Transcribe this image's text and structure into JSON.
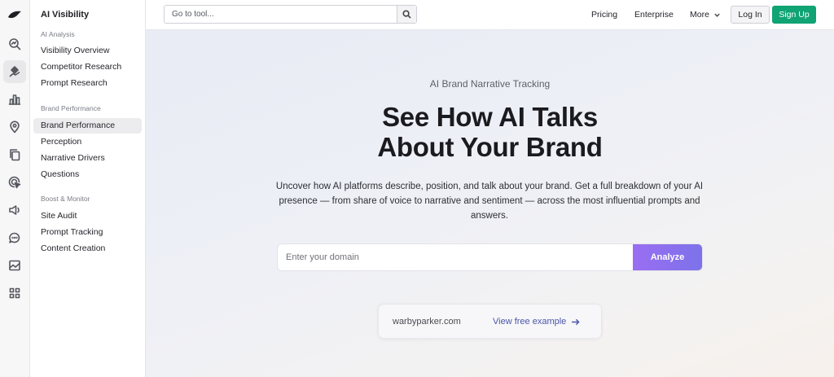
{
  "icons": {
    "logo": "bird-logo-icon",
    "rail": [
      "analytics-search-icon",
      "ai-visibility-icon",
      "bar-chart-icon",
      "location-pin-icon",
      "copy-pages-icon",
      "target-cursor-icon",
      "megaphone-icon",
      "chat-bubble-icon",
      "image-chart-icon",
      "grid-apps-icon"
    ],
    "search": "magnifier-icon",
    "more": "chevron-down-icon",
    "arrow": "arrow-right-icon"
  },
  "sidebar": {
    "title": "AI Visibility",
    "sections": [
      {
        "label": "AI Analysis",
        "items": [
          "Visibility Overview",
          "Competitor Research",
          "Prompt Research"
        ]
      },
      {
        "label": "Brand Performance",
        "items": [
          "Brand Performance",
          "Perception",
          "Narrative Drivers",
          "Questions"
        ]
      },
      {
        "label": "Boost & Monitor",
        "items": [
          "Site Audit",
          "Prompt Tracking",
          "Content Creation"
        ]
      }
    ],
    "active_item": "Brand Performance"
  },
  "topbar": {
    "search_placeholder": "Go to tool...",
    "nav": {
      "pricing": "Pricing",
      "enterprise": "Enterprise",
      "more": "More"
    },
    "login": "Log In",
    "signup": "Sign Up"
  },
  "hero": {
    "eyebrow": "AI Brand Narrative Tracking",
    "headline_line1": "See How AI Talks",
    "headline_line2": "About Your Brand",
    "description": "Uncover how AI platforms describe, position, and talk about your brand. Get a full breakdown of your AI presence — from share of voice to narrative and sentiment — across the most influential prompts and answers.",
    "domain_placeholder": "Enter your domain",
    "analyze": "Analyze",
    "example_domain": "warbyparker.com",
    "example_link": "View free example"
  },
  "colors": {
    "accent_green": "#10a373",
    "analyze_purple": "#8a70ee",
    "link_blue": "#4a55a8"
  }
}
